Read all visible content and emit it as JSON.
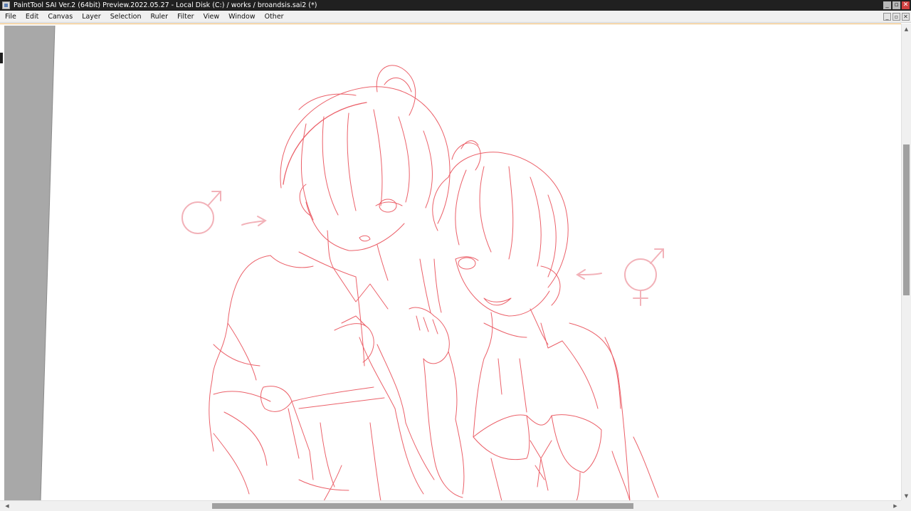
{
  "window": {
    "title": "PaintTool SAI Ver.2 (64bit) Preview.2022.05.27 - Local Disk (C:) / works / broandsis.sai2 (*)",
    "controls": {
      "minimize": "_",
      "restore": "▫",
      "close": "✕"
    }
  },
  "menu": {
    "items": [
      "File",
      "Edit",
      "Canvas",
      "Layer",
      "Selection",
      "Ruler",
      "Filter",
      "View",
      "Window",
      "Other"
    ]
  },
  "document_controls": {
    "minimize": "_",
    "restore": "▫",
    "close": "✕"
  },
  "canvas": {
    "sketch_color": "#e8454f",
    "background_color": "#ffffff",
    "outside_color": "#a8a8a8"
  },
  "scrollbars": {
    "up_arrow": "▲",
    "down_arrow": "▼",
    "left_arrow": "◀",
    "right_arrow": "▶"
  }
}
